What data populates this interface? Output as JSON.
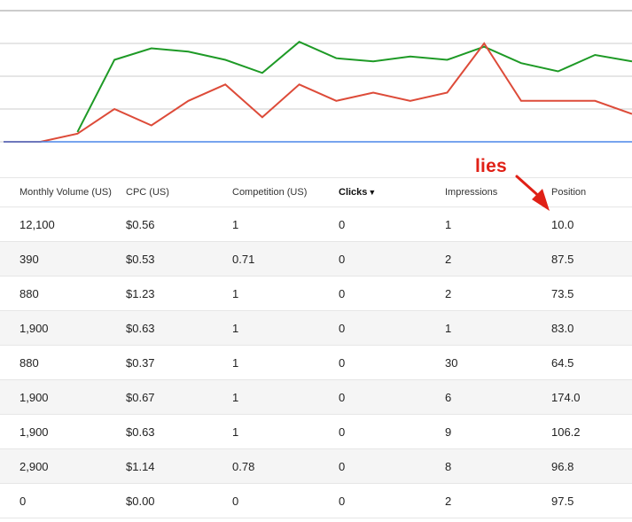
{
  "chart_data": {
    "type": "line",
    "title": "",
    "xlabel": "",
    "ylabel": "",
    "grid": true,
    "ylim": [
      0,
      4
    ],
    "x": [
      0,
      1,
      2,
      3,
      4,
      5,
      6,
      7,
      8,
      9,
      10,
      11,
      12,
      13,
      14,
      15,
      16,
      17
    ],
    "series": [
      {
        "color": "#1e9a26",
        "values": [
          null,
          null,
          0.3,
          2.5,
          2.85,
          2.75,
          2.5,
          2.1,
          3.05,
          2.55,
          2.45,
          2.6,
          2.5,
          2.9,
          2.4,
          2.15,
          2.65,
          2.45
        ]
      },
      {
        "color": "#dd4b39",
        "values": [
          0,
          0,
          0.25,
          1.0,
          0.5,
          1.25,
          1.75,
          0.75,
          1.75,
          1.25,
          1.5,
          1.25,
          1.5,
          3.0,
          1.25,
          1.25,
          1.25,
          0.85
        ]
      },
      {
        "color": "#4a86e8",
        "values": [
          0,
          0,
          0,
          0,
          0,
          0,
          0,
          0,
          0,
          0,
          0,
          0,
          0,
          0,
          0,
          0,
          0,
          0
        ]
      }
    ]
  },
  "table": {
    "headers": [
      {
        "label": "Monthly Volume (US)"
      },
      {
        "label": "CPC (US)"
      },
      {
        "label": "Competition (US)"
      },
      {
        "label": "Clicks",
        "sort_icon": "▼"
      },
      {
        "label": "Impressions"
      },
      {
        "label": "Position"
      }
    ],
    "rows": [
      [
        "12,100",
        "$0.56",
        "1",
        "0",
        "1",
        "10.0"
      ],
      [
        "390",
        "$0.53",
        "0.71",
        "0",
        "2",
        "87.5"
      ],
      [
        "880",
        "$1.23",
        "1",
        "0",
        "2",
        "73.5"
      ],
      [
        "1,900",
        "$0.63",
        "1",
        "0",
        "1",
        "83.0"
      ],
      [
        "880",
        "$0.37",
        "1",
        "0",
        "30",
        "64.5"
      ],
      [
        "1,900",
        "$0.67",
        "1",
        "0",
        "6",
        "174.0"
      ],
      [
        "1,900",
        "$0.63",
        "1",
        "0",
        "9",
        "106.2"
      ],
      [
        "2,900",
        "$1.14",
        "0.78",
        "0",
        "8",
        "96.8"
      ],
      [
        "0",
        "$0.00",
        "0",
        "0",
        "2",
        "97.5"
      ]
    ]
  },
  "annotation": {
    "label": "lies",
    "color": "#e02016",
    "icon": "red-arrow-icon"
  }
}
